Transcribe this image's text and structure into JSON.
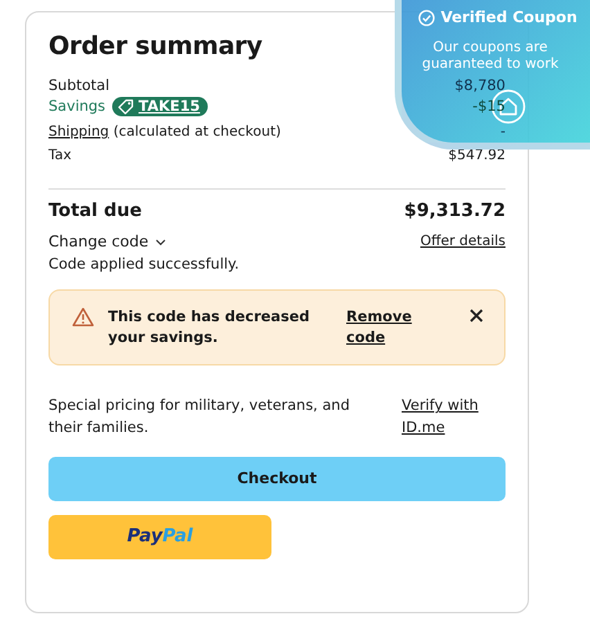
{
  "summary": {
    "title": "Order summary",
    "subtotal": {
      "label": "Subtotal",
      "value": "$8,780"
    },
    "savings": {
      "label": "Savings",
      "code": "TAKE15",
      "value": "-$15"
    },
    "shipping": {
      "link": "Shipping",
      "note": "(calculated at checkout)",
      "value": "-"
    },
    "tax": {
      "label": "Tax",
      "value": "$547.92"
    },
    "total": {
      "label": "Total due",
      "value": "$9,313.72"
    },
    "change_code": {
      "label": "Change code",
      "expanded": false
    },
    "offer_details": "Offer details",
    "status": "Code applied successfully.",
    "alert": {
      "message": "This code has decreased your savings.",
      "action": "Remove code"
    },
    "military": {
      "text": "Special pricing for military, veterans, and their families.",
      "link": "Verify with ID.me"
    },
    "checkout": "Checkout",
    "paypal": [
      "Pay",
      "Pal"
    ]
  },
  "badge": {
    "title": "Verified Coupon",
    "subtitle": "Our coupons are guaranteed to work"
  }
}
